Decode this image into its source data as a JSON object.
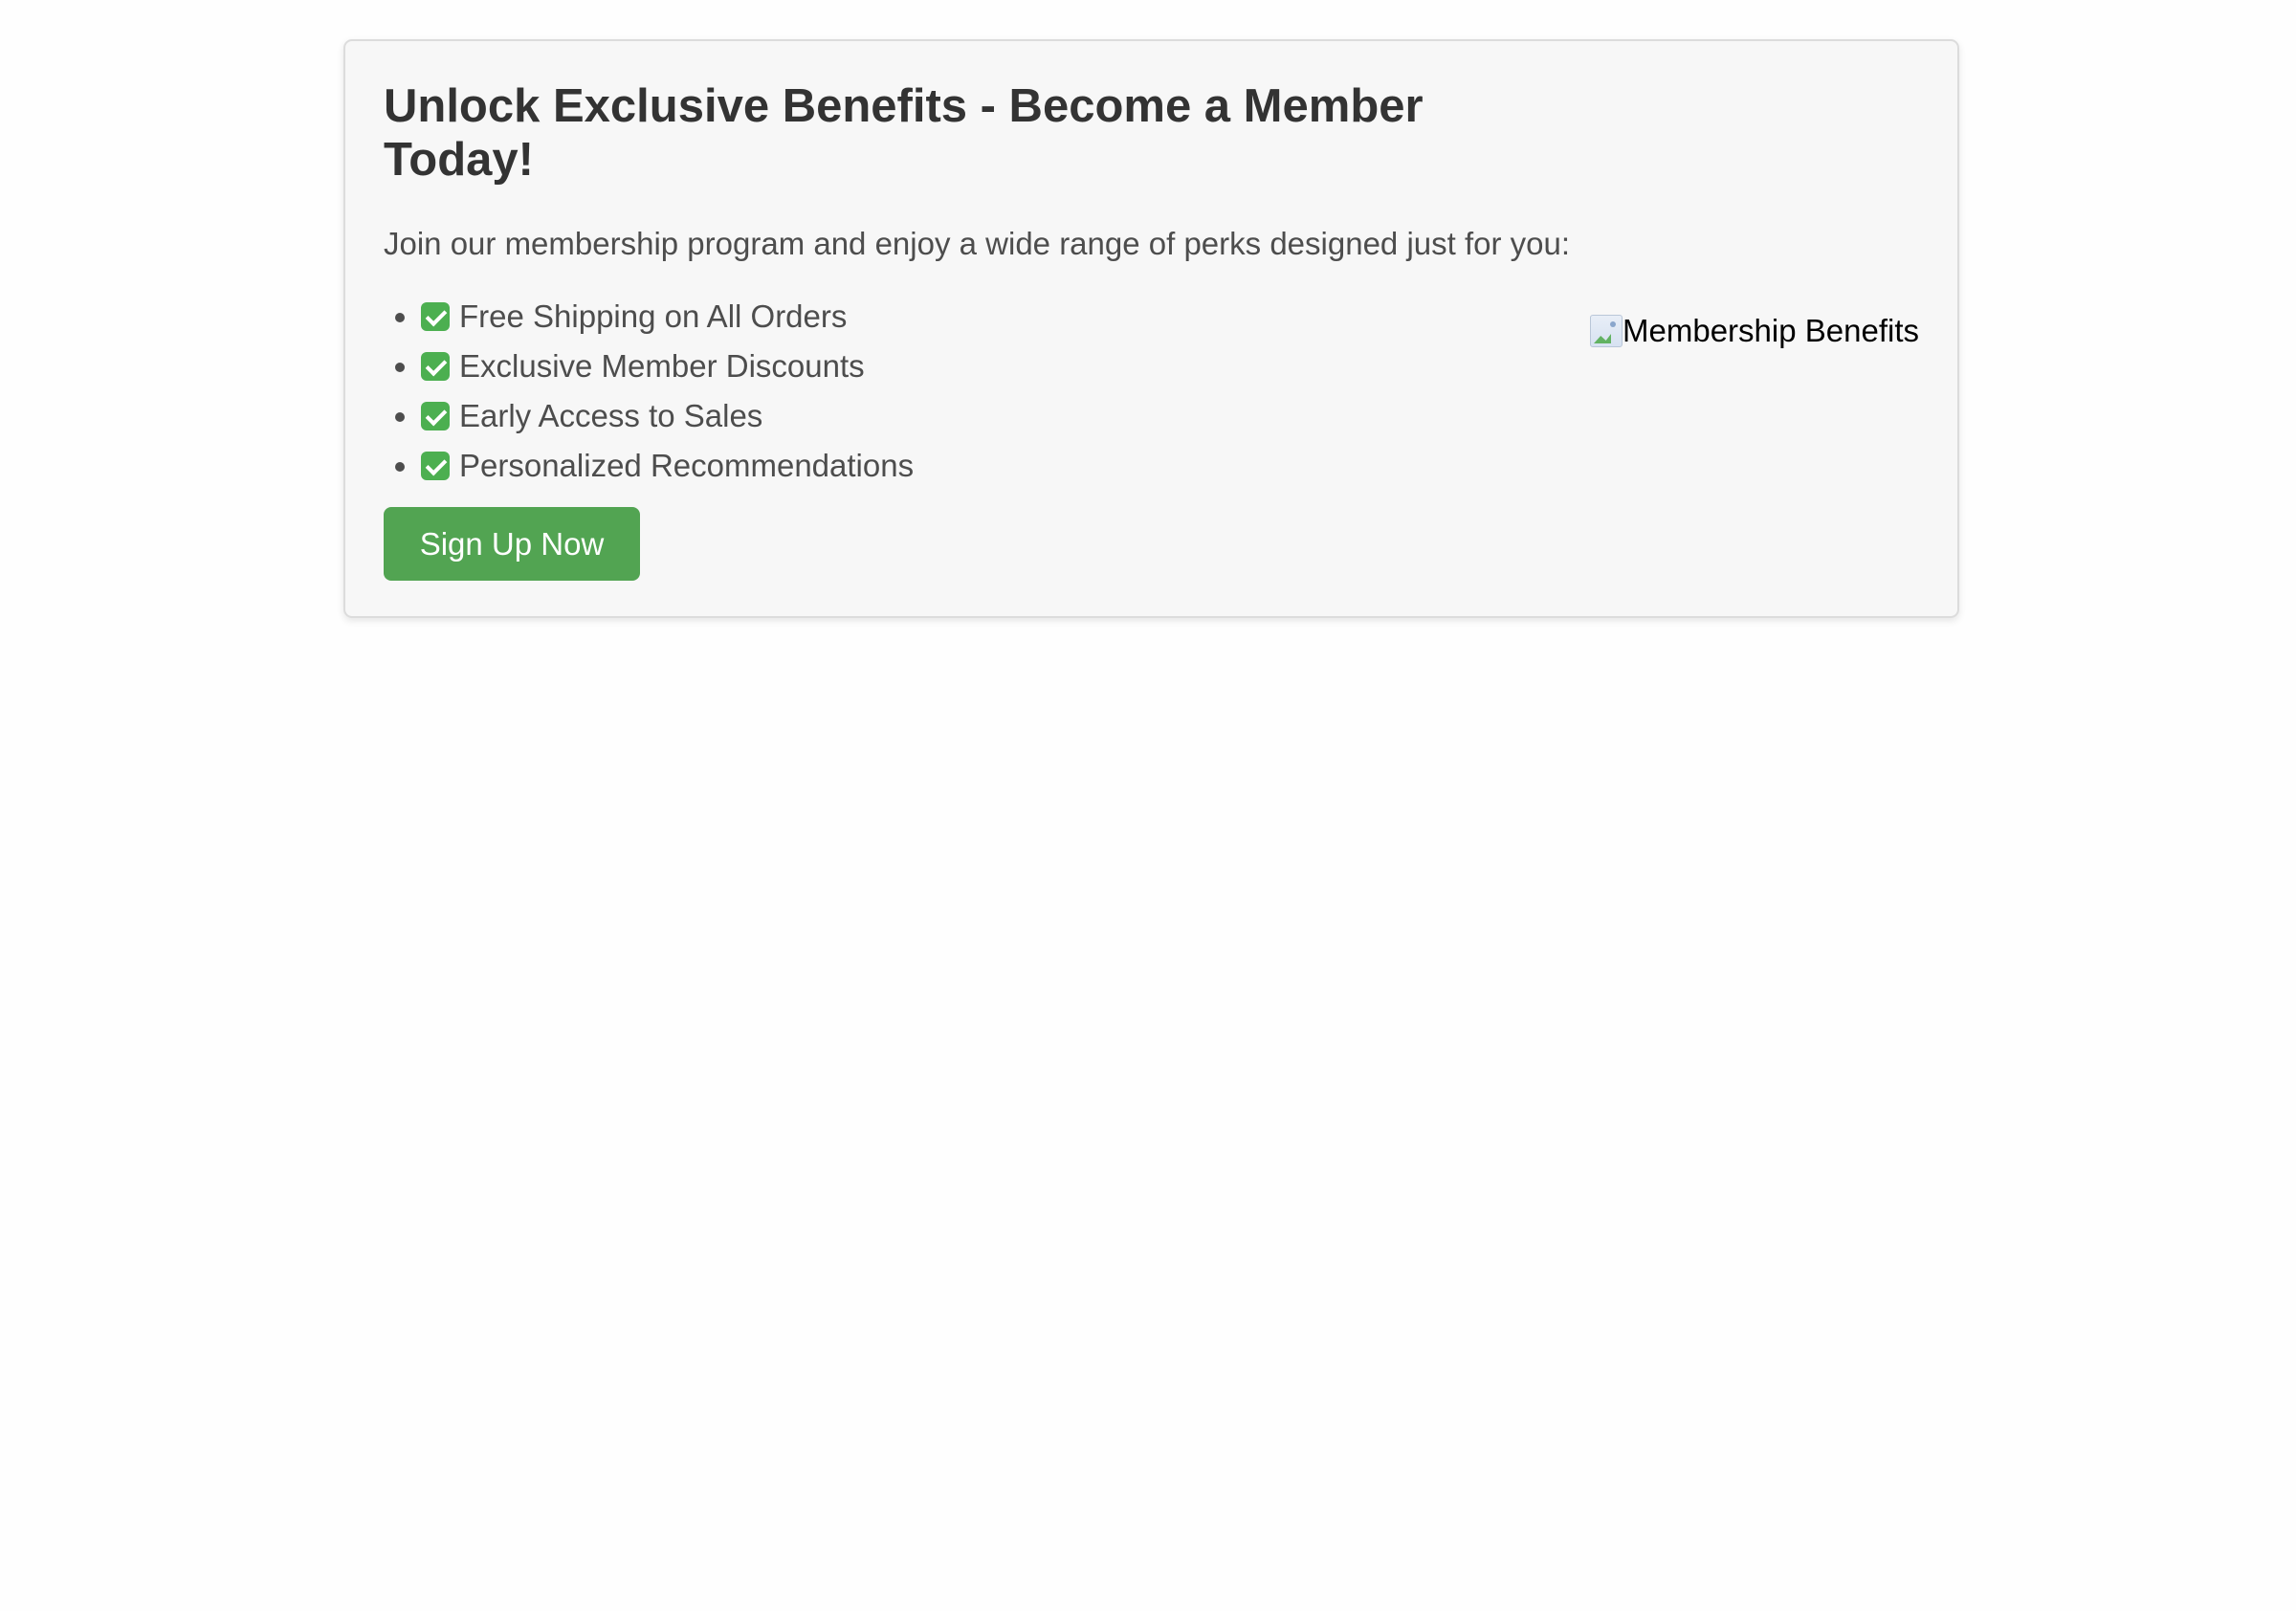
{
  "membership_card": {
    "title": "Unlock Exclusive Benefits - Become a Member Today!",
    "intro": "Join our membership program and enjoy a wide range of perks designed just for you:",
    "benefits": [
      "Free Shipping on All Orders",
      "Exclusive Member Discounts",
      "Early Access to Sales",
      "Personalized Recommendations"
    ],
    "cta_label": "Sign Up Now",
    "image_alt": "Membership Benefits",
    "icons": {
      "benefit_bullet": "check-icon",
      "image": "broken-image-icon"
    },
    "colors": {
      "button": "#52a452",
      "check": "#4caf50",
      "card_background": "#f7f7f7",
      "title": "#333333",
      "text": "#4d4d4d"
    }
  }
}
